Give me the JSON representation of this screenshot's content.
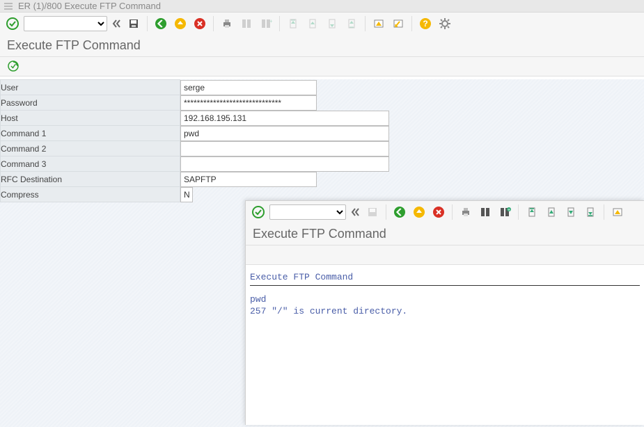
{
  "window": {
    "title": "ER (1)/800 Execute FTP Command"
  },
  "screen": {
    "title": "Execute FTP Command"
  },
  "toolbar": {
    "command_value": "",
    "icons": {
      "enter": "enter-icon",
      "back": "back-icon",
      "save": "save-icon",
      "nav_back": "nav-back-icon",
      "nav_exit": "nav-exit-icon",
      "nav_cancel": "nav-cancel-icon",
      "print": "print-icon",
      "find": "find-icon",
      "find_next": "find-next-icon",
      "first_page": "first-page-icon",
      "prev_page": "prev-page-icon",
      "next_page": "next-page-icon",
      "last_page": "last-page-icon",
      "new_session": "new-session-icon",
      "shortcut": "shortcut-icon",
      "help": "help-icon",
      "customize": "customize-icon"
    }
  },
  "app_toolbar": {
    "execute_icon": "execute-icon"
  },
  "form": {
    "labels": {
      "user": "User",
      "password": "Password",
      "host": "Host",
      "command1": "Command 1",
      "command2": "Command 2",
      "command3": "Command 3",
      "rfc_dest": "RFC Destination",
      "compress": "Compress"
    },
    "values": {
      "user": "serge",
      "password": "******************************",
      "host": "192.168.195.131",
      "command1": "pwd",
      "command2": "",
      "command3": "",
      "rfc_dest": "SAPFTP",
      "compress": "N"
    }
  },
  "overlay": {
    "screen_title": "Execute FTP Command",
    "result": {
      "header": "Execute FTP Command",
      "lines": [
        "pwd",
        "257 \"/\" is current directory."
      ]
    }
  }
}
